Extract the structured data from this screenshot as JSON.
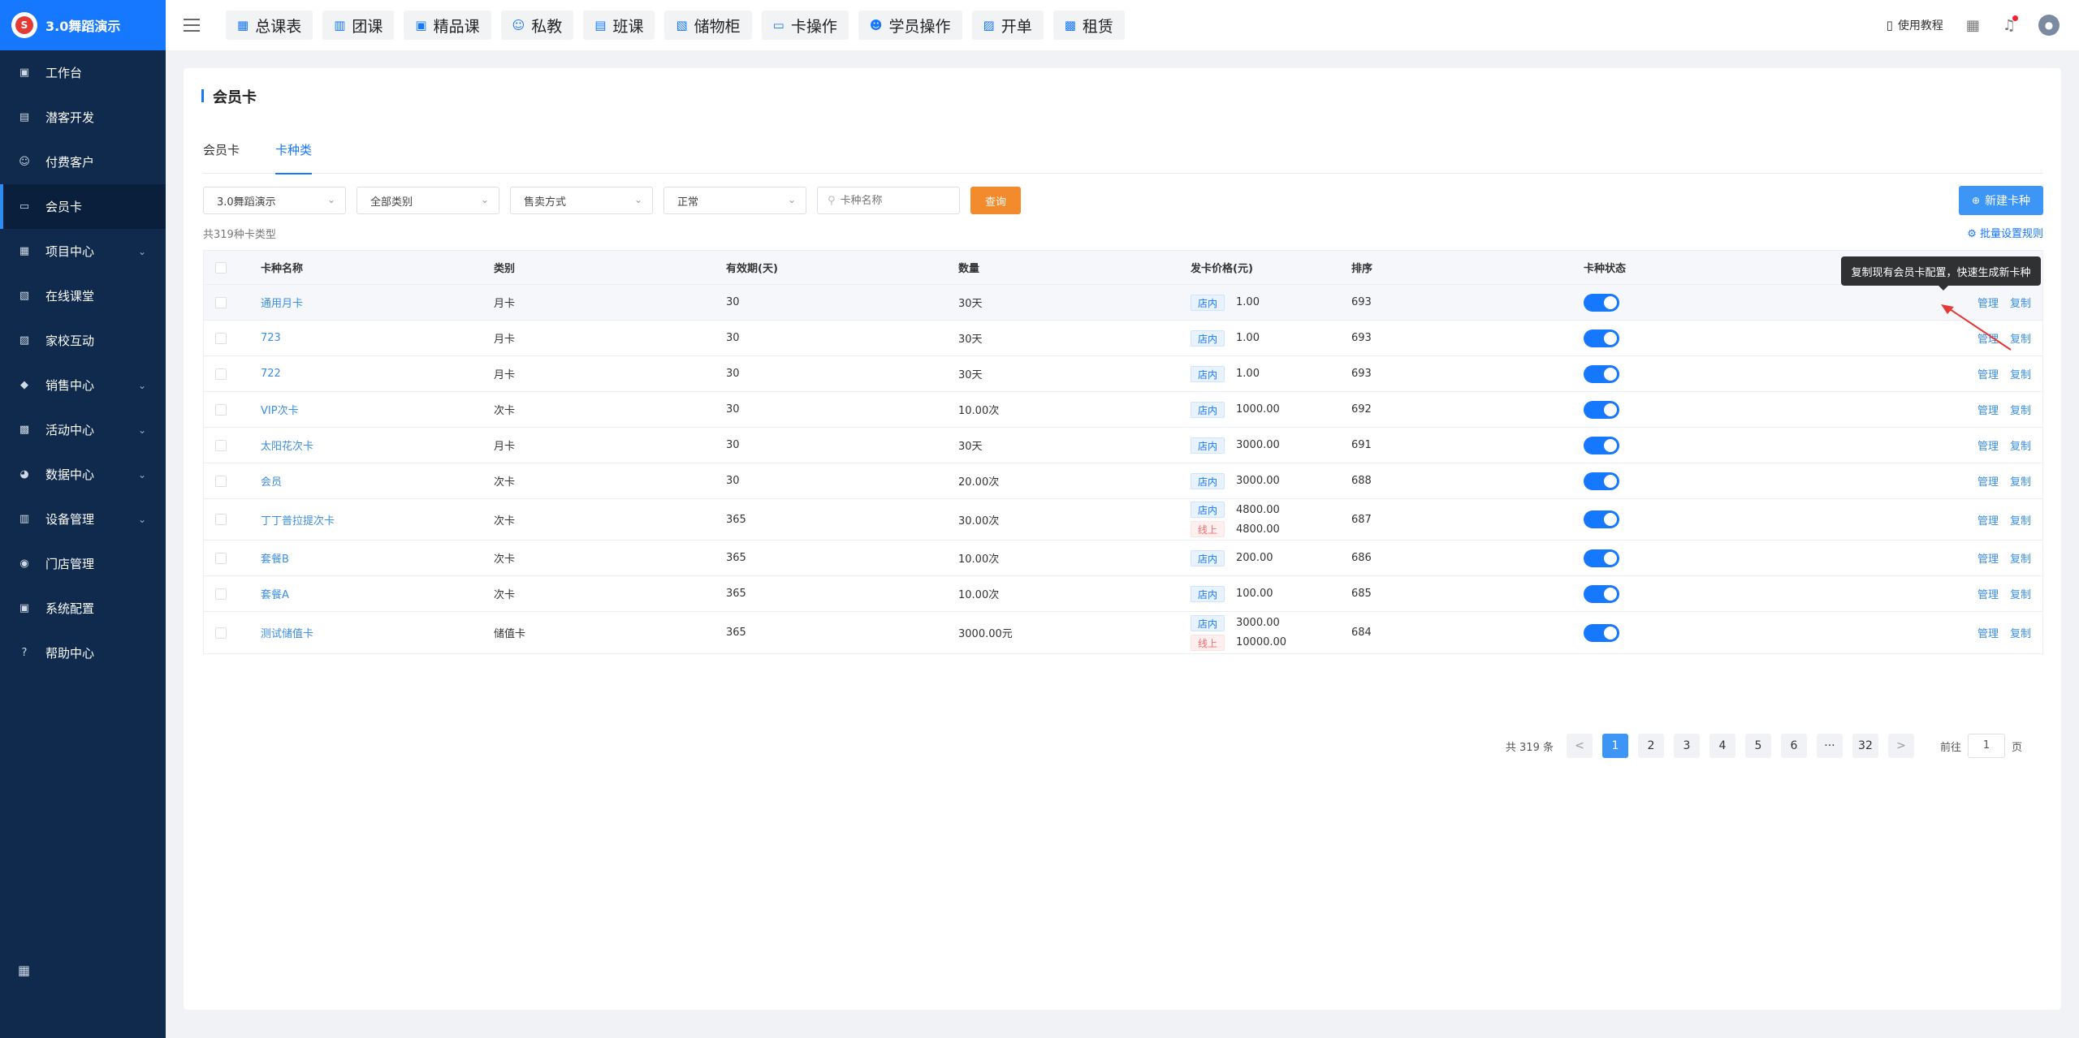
{
  "app": {
    "title": "3.0舞蹈演示",
    "logo_text": "S"
  },
  "sidebar": {
    "items": [
      {
        "label": "工作台",
        "icon": "workbench-icon",
        "glyph": "▣",
        "caret": false,
        "active": false
      },
      {
        "label": "潜客开发",
        "icon": "prospect-icon",
        "glyph": "▤",
        "caret": false,
        "active": false
      },
      {
        "label": "付费客户",
        "icon": "customers-icon",
        "glyph": "☺",
        "caret": false,
        "active": false
      },
      {
        "label": "会员卡",
        "icon": "card-icon",
        "glyph": "▭",
        "caret": false,
        "active": true
      },
      {
        "label": "项目中心",
        "icon": "project-icon",
        "glyph": "▦",
        "caret": true,
        "active": false
      },
      {
        "label": "在线课堂",
        "icon": "classroom-icon",
        "glyph": "▧",
        "caret": false,
        "active": false
      },
      {
        "label": "家校互动",
        "icon": "home-school-icon",
        "glyph": "▨",
        "caret": false,
        "active": false
      },
      {
        "label": "销售中心",
        "icon": "tag-icon",
        "glyph": "◆",
        "caret": true,
        "active": false
      },
      {
        "label": "活动中心",
        "icon": "activity-icon",
        "glyph": "▩",
        "caret": true,
        "active": false
      },
      {
        "label": "数据中心",
        "icon": "pie-chart-icon",
        "glyph": "◕",
        "caret": true,
        "active": false
      },
      {
        "label": "设备管理",
        "icon": "device-icon",
        "glyph": "▥",
        "caret": true,
        "active": false
      },
      {
        "label": "门店管理",
        "icon": "store-icon",
        "glyph": "◉",
        "caret": false,
        "active": false
      },
      {
        "label": "系统配置",
        "icon": "settings-icon",
        "glyph": "▣",
        "caret": false,
        "active": false
      },
      {
        "label": "帮助中心",
        "icon": "help-icon",
        "glyph": "?",
        "caret": false,
        "active": false
      }
    ]
  },
  "topnav": {
    "tabs": [
      {
        "label": "总课表",
        "icon": "calendar-icon"
      },
      {
        "label": "团课",
        "icon": "book-icon"
      },
      {
        "label": "精品课",
        "icon": "bookmark-icon"
      },
      {
        "label": "私教",
        "icon": "users-icon"
      },
      {
        "label": "班课",
        "icon": "class-icon"
      },
      {
        "label": "储物柜",
        "icon": "locker-icon"
      },
      {
        "label": "卡操作",
        "icon": "card-op-icon"
      },
      {
        "label": "学员操作",
        "icon": "student-icon"
      },
      {
        "label": "开单",
        "icon": "order-icon"
      },
      {
        "label": "租赁",
        "icon": "rent-icon"
      }
    ],
    "tutorial": "使用教程"
  },
  "page": {
    "title": "会员卡",
    "tabs": [
      "会员卡",
      "卡种类"
    ],
    "active_tab": 1,
    "filters": {
      "store": "3.0舞蹈演示",
      "category": "全部类别",
      "sale_mode": "售卖方式",
      "status": "正常",
      "search_placeholder": "卡种名称",
      "query_label": "查询"
    },
    "new_button": "新建卡种",
    "count_text": "共319种卡类型",
    "batch_link": "批量设置规则",
    "tooltip": "复制现有会员卡配置，快速生成新卡种"
  },
  "table": {
    "columns": [
      "卡种名称",
      "类别",
      "有效期(天)",
      "数量",
      "发卡价格(元)",
      "排序",
      "卡种状态"
    ],
    "ops": [
      "管理",
      "复制"
    ],
    "rows": [
      {
        "name": "通用月卡",
        "type": "月卡",
        "days": "30",
        "qty": "30天",
        "prices": [
          {
            "tag": "店内",
            "kind": "in",
            "value": "1.00"
          }
        ],
        "sort": "693",
        "on": true
      },
      {
        "name": "723",
        "type": "月卡",
        "days": "30",
        "qty": "30天",
        "prices": [
          {
            "tag": "店内",
            "kind": "in",
            "value": "1.00"
          }
        ],
        "sort": "693",
        "on": true
      },
      {
        "name": "722",
        "type": "月卡",
        "days": "30",
        "qty": "30天",
        "prices": [
          {
            "tag": "店内",
            "kind": "in",
            "value": "1.00"
          }
        ],
        "sort": "693",
        "on": true
      },
      {
        "name": "VIP次卡",
        "type": "次卡",
        "days": "30",
        "qty": "10.00次",
        "prices": [
          {
            "tag": "店内",
            "kind": "in",
            "value": "1000.00"
          }
        ],
        "sort": "692",
        "on": true
      },
      {
        "name": "太阳花次卡",
        "type": "月卡",
        "days": "30",
        "qty": "30天",
        "prices": [
          {
            "tag": "店内",
            "kind": "in",
            "value": "3000.00"
          }
        ],
        "sort": "691",
        "on": true
      },
      {
        "name": "会员",
        "type": "次卡",
        "days": "30",
        "qty": "20.00次",
        "prices": [
          {
            "tag": "店内",
            "kind": "in",
            "value": "3000.00"
          }
        ],
        "sort": "688",
        "on": true
      },
      {
        "name": "丁丁普拉提次卡",
        "type": "次卡",
        "days": "365",
        "qty": "30.00次",
        "prices": [
          {
            "tag": "店内",
            "kind": "in",
            "value": "4800.00"
          },
          {
            "tag": "线上",
            "kind": "on",
            "value": "4800.00"
          }
        ],
        "sort": "687",
        "on": true
      },
      {
        "name": "套餐B",
        "type": "次卡",
        "days": "365",
        "qty": "10.00次",
        "prices": [
          {
            "tag": "店内",
            "kind": "in",
            "value": "200.00"
          }
        ],
        "sort": "686",
        "on": true
      },
      {
        "name": "套餐A",
        "type": "次卡",
        "days": "365",
        "qty": "10.00次",
        "prices": [
          {
            "tag": "店内",
            "kind": "in",
            "value": "100.00"
          }
        ],
        "sort": "685",
        "on": true
      },
      {
        "name": "测试储值卡",
        "type": "储值卡",
        "days": "365",
        "qty": "3000.00元",
        "prices": [
          {
            "tag": "店内",
            "kind": "in",
            "value": "3000.00"
          },
          {
            "tag": "线上",
            "kind": "on",
            "value": "10000.00"
          }
        ],
        "sort": "684",
        "on": true
      }
    ]
  },
  "pagination": {
    "total": "共 319 条",
    "pages": [
      "1",
      "2",
      "3",
      "4",
      "5",
      "6",
      "···",
      "32"
    ],
    "current": "1",
    "prev": "<",
    "next": ">",
    "goto_label": "前往",
    "goto_value": "1",
    "page_suffix": "页"
  }
}
